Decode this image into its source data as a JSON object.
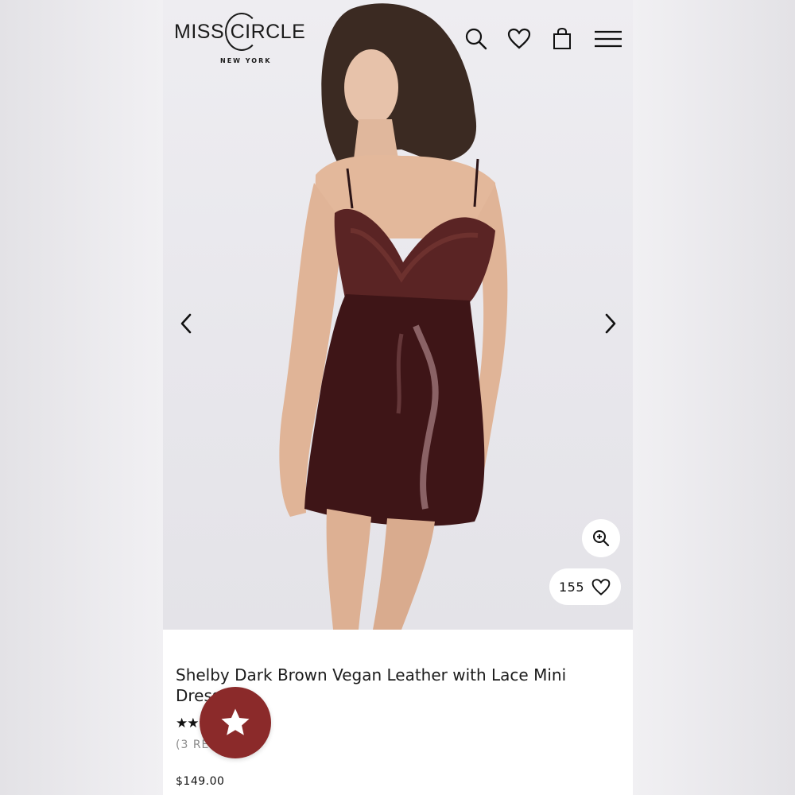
{
  "brand": {
    "name": "MISS CIRCLE",
    "location": "NEW YORK"
  },
  "header_icons": [
    "search-icon",
    "heart-icon",
    "shopping-bag-icon",
    "menu-icon"
  ],
  "gallery": {
    "prev_icon": "chevron-left-icon",
    "next_icon": "chevron-right-icon",
    "zoom_icon": "zoom-in-icon"
  },
  "favorites": {
    "count": "155"
  },
  "product": {
    "title": "Shelby Dark Brown Vegan Leather with Lace Mini Dress",
    "rating_stars": "★★★★★",
    "reviews_label": "(3 REVIEWS)",
    "price": "$149.00"
  },
  "reward_button": {
    "icon": "star-icon",
    "color": "#8b2a2a"
  }
}
